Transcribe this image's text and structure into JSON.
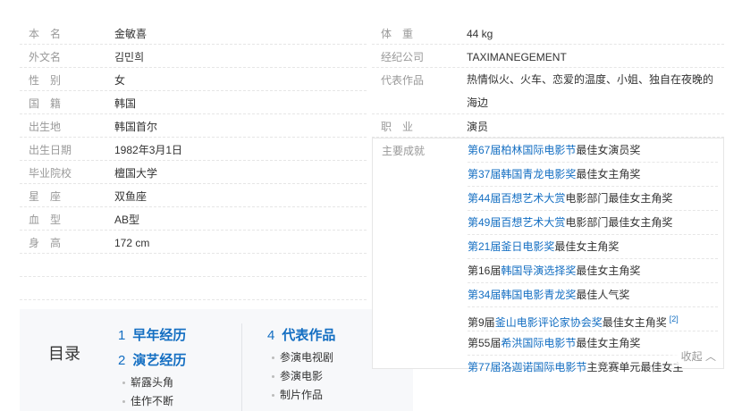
{
  "basic_info_left": [
    {
      "label": "本　名",
      "value": "金敏喜",
      "link": false
    },
    {
      "label": "外文名",
      "value": "김민희",
      "link": false
    },
    {
      "label": "性　别",
      "value": "女",
      "link": false
    },
    {
      "label": "国　籍",
      "value": "韩国",
      "link": true
    },
    {
      "label": "出生地",
      "value": "韩国首尔",
      "link": false
    },
    {
      "label": "出生日期",
      "value": "1982年3月1日",
      "link": false
    },
    {
      "label": "毕业院校",
      "value": "檀国大学",
      "link": true
    },
    {
      "label": "星　座",
      "value": "双鱼座",
      "link": true
    },
    {
      "label": "血　型",
      "value": "AB型",
      "link": false
    },
    {
      "label": "身　高",
      "value": "172 cm",
      "link": false
    }
  ],
  "basic_info_right": {
    "weight": {
      "label": "体　重",
      "value": "44 kg"
    },
    "agency": {
      "label": "经纪公司",
      "value": "TAXIMANEGEMENT"
    },
    "works": {
      "label": "代表作品",
      "value": "热情似火、火车、恋爱的温度、小姐、独自在夜晚的海边"
    },
    "occupation": {
      "label": "职　业",
      "value": "演员"
    }
  },
  "achievements": {
    "label": "主要成就",
    "items": [
      {
        "pre": "",
        "link": "第67届柏林国际电影节",
        "post": "最佳女演员奖",
        "ref": ""
      },
      {
        "pre": "",
        "link": "第37届韩国青龙电影奖",
        "post": "最佳女主角奖",
        "ref": ""
      },
      {
        "pre": "",
        "link": "第44届百想艺术大赏",
        "post": "电影部门最佳女主角奖",
        "ref": ""
      },
      {
        "pre": "",
        "link": "第49届百想艺术大赏",
        "post": "电影部门最佳女主角奖",
        "ref": ""
      },
      {
        "pre": "",
        "link": "第21届釜日电影奖",
        "post": "最佳女主角奖",
        "ref": ""
      },
      {
        "pre": "第16届",
        "link": "韩国导演选择奖",
        "post": "最佳女主角奖",
        "ref": ""
      },
      {
        "pre": "",
        "link": "第34届韩国电影青龙奖",
        "post": "最佳人气奖",
        "ref": ""
      },
      {
        "pre": "第9届",
        "link": "釜山电影评论家协会奖",
        "post": "最佳女主角奖",
        "ref": "[2]"
      },
      {
        "pre": "第55届",
        "link": "希洪国际电影节",
        "post": "最佳女主角奖",
        "ref": ""
      },
      {
        "pre": "",
        "link": "第77届洛迦诺国际电影节",
        "post": "主竞赛单元最佳女主",
        "ref": ""
      }
    ],
    "collapse_label": "收起 ︿"
  },
  "toc": {
    "title": "目录",
    "sections": [
      {
        "num": "1",
        "title": "早年经历",
        "subs": []
      },
      {
        "num": "2",
        "title": "演艺经历",
        "subs": [
          "崭露头角",
          "佳作不断"
        ]
      },
      {
        "num": "4",
        "title": "代表作品",
        "subs": [
          "参演电视剧",
          "参演电影",
          "制片作品"
        ]
      }
    ]
  }
}
